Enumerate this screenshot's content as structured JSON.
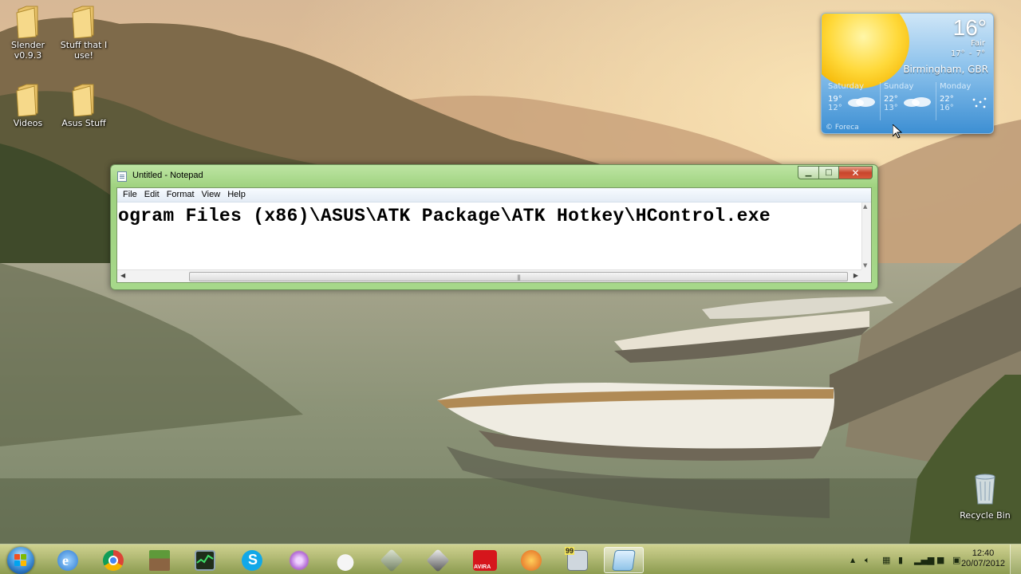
{
  "desktop": {
    "icons": [
      {
        "label": "Slender v0.9.3",
        "icon": "folder-icon"
      },
      {
        "label": "Stuff that I use!",
        "icon": "folder-icon"
      },
      {
        "label": "Videos",
        "icon": "folder-icon"
      },
      {
        "label": "Asus Stuff",
        "icon": "folder-icon"
      }
    ],
    "recycle_bin": "Recycle Bin"
  },
  "weather": {
    "temp": "16°",
    "condition": "Fair",
    "hilo": "17° - 7°",
    "location": "Birmingham, GBR",
    "forecast": [
      {
        "day": "Saturday",
        "hi": "19°",
        "lo": "12°"
      },
      {
        "day": "Sunday",
        "hi": "22°",
        "lo": "13°"
      },
      {
        "day": "Monday",
        "hi": "22°",
        "lo": "16°"
      }
    ],
    "credit": "© Foreca"
  },
  "notepad": {
    "title": "Untitled - Notepad",
    "menu": [
      "File",
      "Edit",
      "Format",
      "View",
      "Help"
    ],
    "content": "ogram Files (x86)\\ASUS\\ATK Package\\ATK Hotkey\\HControl.exe",
    "minimize": "▁",
    "maximize": "□",
    "close": "✕"
  },
  "taskbar": {
    "items": [
      "internet-explorer-icon",
      "chrome-icon",
      "minecraft-icon",
      "task-manager-icon",
      "skype-icon",
      "flower-app-icon",
      "cat-app-icon",
      "game-app-1-icon",
      "game-app-2-icon",
      "avira-icon",
      "cc-cleaner-icon",
      "computer-99-icon",
      "notepad-icon"
    ],
    "avira_label": "AVIRA",
    "badge_99": "99",
    "clock_time": "12:40",
    "clock_date": "20/07/2012",
    "colors": {
      "taskbar": "#9fc06a",
      "start_orb": "#4a9be0"
    }
  }
}
